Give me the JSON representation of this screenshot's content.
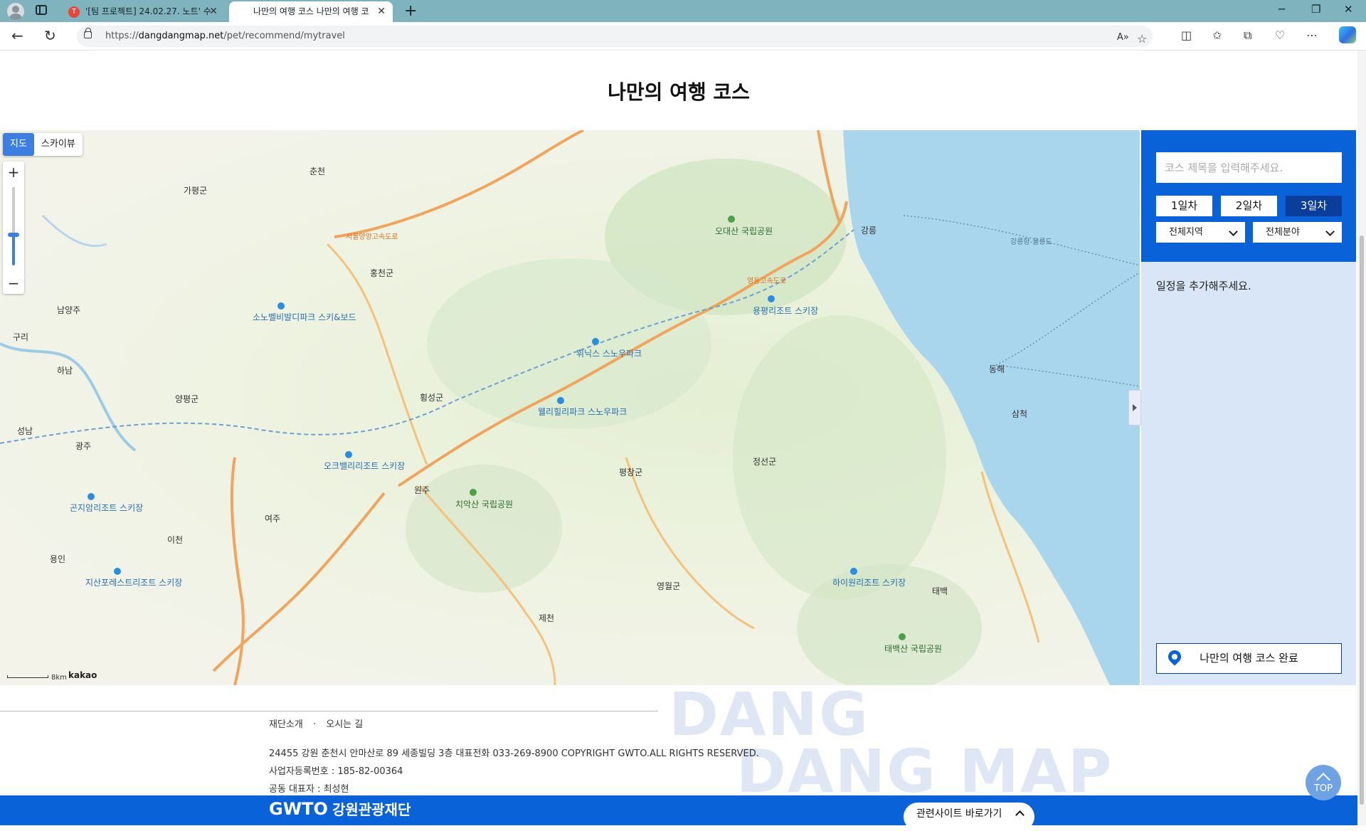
{
  "browser": {
    "tabs": [
      {
        "title": "'[팀 프로젝트] 24.02.27. 노트' 수",
        "favicon_letter": "T"
      },
      {
        "title": "나만의 여행 코스 나만의 여행 코"
      }
    ],
    "url_prefix": "https://",
    "url_domain": "dangdangmap.net",
    "url_path": "/pet/recommend/mytravel"
  },
  "page": {
    "title": "나만의 여행 코스"
  },
  "map": {
    "type_buttons": [
      "지도",
      "스카이뷰"
    ],
    "zoom_in": "+",
    "zoom_out": "−",
    "scale_label": "8km",
    "provider": "kakao",
    "labels": {
      "chuncheon": "춘천",
      "gangneung": "강릉",
      "hongcheon": "홍천군",
      "hoengseong": "횡성군",
      "wonju": "원주",
      "pyeongchang": "평창군",
      "jeongseon": "정선군",
      "donghae": "동해",
      "samcheok": "삼척",
      "yeongwol": "영월군",
      "jecheon": "제천",
      "taebaek": "태백",
      "yeoju": "여주",
      "icheon": "이천",
      "yongin": "용인",
      "gwangju": "광주",
      "seongnam": "성남",
      "hanam": "하남",
      "guri": "구리",
      "namyangju": "남양주",
      "yangpyeong": "양평군",
      "gapyeong": "가평군",
      "odaesan": "오대산 국립공원",
      "chiaksan": "치악산 국립공원",
      "taebaeksan": "태백산 국립공원",
      "yongpyong": "용평리조트 스키장",
      "phoenix": "휘닉스 스노우파크",
      "wellihilli": "웰리힐리파크 스노우파크",
      "sonovelvit": "소노벨비발디파크 스키&보드",
      "oakvalley": "오크밸리리조트 스키장",
      "high1": "하이원리조트 스키장",
      "konjiam": "곤지암리조트 스키장",
      "jisan": "지산포레스트리조트 스키장",
      "yeongdong_exp": "영동고속도로",
      "seoulyangyang_exp": "서울양양고속도로",
      "route_gangneung_ulleung": "강릉항-울릉도"
    }
  },
  "panel": {
    "title_placeholder": "코스 제목을 입력해주세요.",
    "days": [
      "1일차",
      "2일차",
      "3일차"
    ],
    "active_day": "3일차",
    "region_select": "전체지역",
    "category_select": "전체분야",
    "empty_message": "일정을 추가해주세요.",
    "complete_button": "나만의 여행 코스 완료"
  },
  "footer": {
    "links": [
      "재단소개",
      "·",
      "오시는 길"
    ],
    "address": "24455 강원 춘천시 안마산로 89 세종빌딩 3층 대표전화 033-269-8900 COPYRIGHT GWTO.ALL RIGHTS RESERVED.",
    "business_no": "사업자등록번호 : 185-82-00364",
    "ceo": "공동 대표자 : 최성현",
    "watermark_1": "DANG",
    "watermark_2": "DANG MAP",
    "logo": "GWTO",
    "org_name": "강원관광재단",
    "related_sites": "관련사이트 바로가기",
    "top_button": "TOP"
  }
}
